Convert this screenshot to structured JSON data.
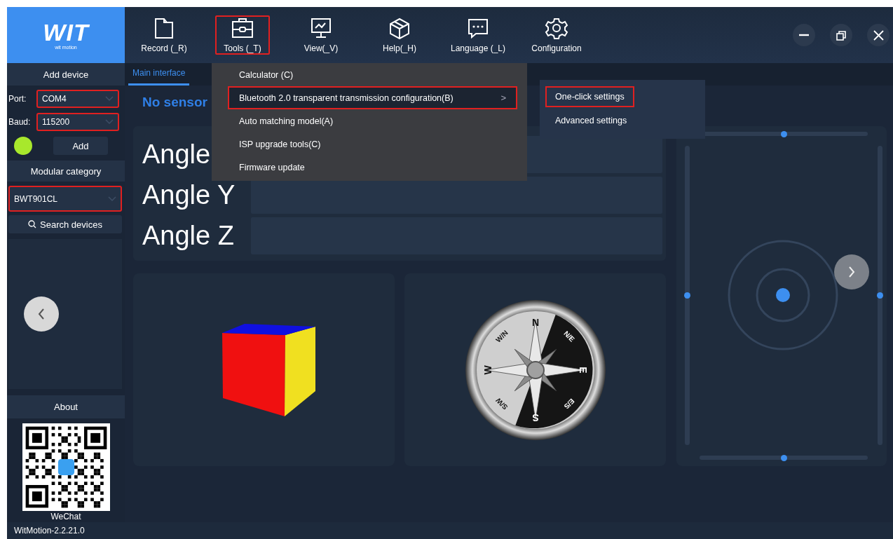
{
  "logo": {
    "text": "WIT",
    "subtitle": "wit motion"
  },
  "toolbar": [
    {
      "label": "Record (_R)",
      "kind": "record",
      "highlighted": false
    },
    {
      "label": "Tools (_T)",
      "kind": "tools",
      "highlighted": true
    },
    {
      "label": "View(_V)",
      "kind": "view",
      "highlighted": false
    },
    {
      "label": "Help(_H)",
      "kind": "help",
      "highlighted": false
    },
    {
      "label": "Language (_L)",
      "kind": "language",
      "highlighted": false
    },
    {
      "label": "Configuration",
      "kind": "configuration",
      "highlighted": false
    }
  ],
  "sidebar": {
    "add_device": {
      "title": "Add device",
      "port": {
        "label": "Port:",
        "value": "COM4",
        "highlighted": true
      },
      "baud": {
        "label": "Baud:",
        "value": "115200",
        "highlighted": true
      },
      "add_button": "Add"
    },
    "modular_category": {
      "title": "Modular category",
      "value": "BWT901CL",
      "highlighted": true
    },
    "search_button": "Search devices",
    "about": {
      "title": "About",
      "caption": "WeChat"
    }
  },
  "tabs": [
    {
      "label": "Main interface",
      "selected": true
    }
  ],
  "heading": "No sensor",
  "angles": [
    {
      "label": "Angle"
    },
    {
      "label": "Angle Y"
    },
    {
      "label": "Angle Z"
    }
  ],
  "compass": {
    "labels": [
      "N",
      "N/E",
      "E",
      "E/S",
      "S",
      "S/W",
      "W",
      "W/N"
    ]
  },
  "joystick": {
    "sliders": [
      {
        "kind": "top",
        "level": 0.5
      },
      {
        "kind": "left",
        "level": 0.5
      },
      {
        "kind": "right",
        "level": 0.5
      },
      {
        "kind": "bottom",
        "level": 0.5
      }
    ]
  },
  "menu": {
    "items": [
      {
        "label": "Calculator (C)",
        "selected": false,
        "highlighted": false
      },
      {
        "label": "Bluetooth 2.0 transparent transmission configuration(B)",
        "selected": true,
        "highlighted": true,
        "submenu_arrow": ">"
      },
      {
        "label": "Auto matching model(A)",
        "selected": false,
        "highlighted": false
      },
      {
        "label": "ISP upgrade tools(C)",
        "selected": false,
        "highlighted": false
      },
      {
        "label": "Firmware update",
        "selected": false,
        "highlighted": false
      }
    ]
  },
  "submenu": {
    "items": [
      {
        "label": "One-click settings",
        "highlighted": true
      },
      {
        "label": "Advanced settings",
        "highlighted": false
      }
    ]
  },
  "status_bar": {
    "version": "WitMotion-2.2.21.0"
  }
}
